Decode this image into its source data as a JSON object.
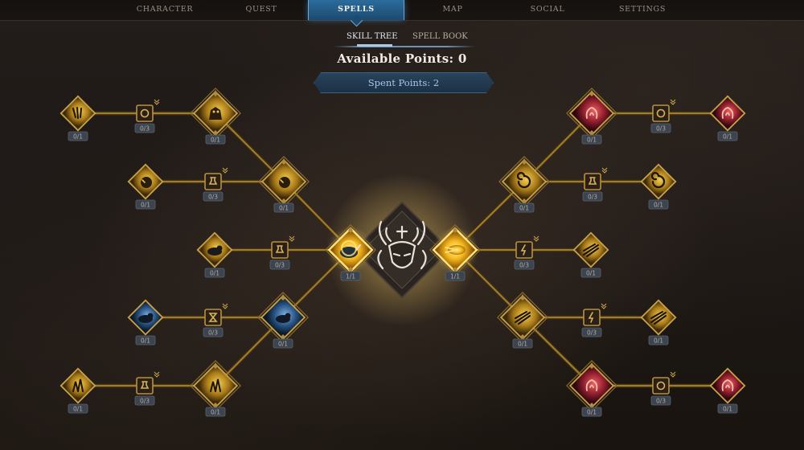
{
  "nav": {
    "tabs": [
      {
        "label": "CHARACTER"
      },
      {
        "label": "QUEST"
      },
      {
        "label": "SPELLS"
      },
      {
        "label": "MAP"
      },
      {
        "label": "SOCIAL"
      },
      {
        "label": "SETTINGS"
      }
    ],
    "active": "SPELLS"
  },
  "subtabs": {
    "skill_tree": "SKILL TREE",
    "spell_book": "SPELL BOOK",
    "active": "SKILL TREE"
  },
  "points": {
    "available": "Available Points: 0",
    "spent": "Spent Points: 2"
  },
  "colors": {
    "accent_blue": "#2b6c9c",
    "gold": "#b9913f",
    "gold_line": "#a07d2e",
    "left_icon": "#c8a033",
    "right_icon": "#c0304a",
    "center_glow": "#f7c52a"
  },
  "center": {
    "name": "class-emblem-icon"
  },
  "nodes": [
    {
      "id": "L1a",
      "icon": "bear-claw-icon",
      "value": "0/1",
      "style": "diamond",
      "tone": "gold"
    },
    {
      "id": "L1b",
      "icon": "ring-icon",
      "value": "0/3",
      "style": "square",
      "tone": "gold",
      "upgrade": true
    },
    {
      "id": "L1c",
      "icon": "earth-golem-icon",
      "value": "0/1",
      "style": "ornate",
      "tone": "gold"
    },
    {
      "id": "L2a",
      "icon": "boulder-icon",
      "value": "0/1",
      "style": "diamond",
      "tone": "gold"
    },
    {
      "id": "L2b",
      "icon": "potion-icon",
      "value": "0/3",
      "style": "square",
      "tone": "gold",
      "upgrade": true
    },
    {
      "id": "L2c",
      "icon": "meteor-icon",
      "value": "0/1",
      "style": "ornate",
      "tone": "gold"
    },
    {
      "id": "L3a",
      "icon": "boar-icon",
      "value": "0/1",
      "style": "diamond",
      "tone": "gold"
    },
    {
      "id": "L3b",
      "icon": "potion-icon",
      "value": "0/3",
      "style": "square",
      "tone": "gold",
      "upgrade": true
    },
    {
      "id": "L3c",
      "icon": "rhino-charge-icon",
      "value": "1/1",
      "style": "ornate",
      "tone": "gold",
      "active": true
    },
    {
      "id": "L4a",
      "icon": "wolf-icon",
      "value": "0/1",
      "style": "diamond",
      "tone": "blue"
    },
    {
      "id": "L4b",
      "icon": "hourglass-icon",
      "value": "0/3",
      "style": "square",
      "tone": "gold",
      "upgrade": true
    },
    {
      "id": "L4c",
      "icon": "beast-icon",
      "value": "0/1",
      "style": "ornate",
      "tone": "blue"
    },
    {
      "id": "L5a",
      "icon": "crystal-icon",
      "value": "0/1",
      "style": "diamond",
      "tone": "gold"
    },
    {
      "id": "L5b",
      "icon": "potion-icon",
      "value": "0/3",
      "style": "square",
      "tone": "gold",
      "upgrade": true
    },
    {
      "id": "L5c",
      "icon": "crystal-cluster-icon",
      "value": "0/1",
      "style": "ornate",
      "tone": "gold"
    },
    {
      "id": "R1a",
      "icon": "red-dragon-icon",
      "value": "0/1",
      "style": "ornate",
      "tone": "red"
    },
    {
      "id": "R1b",
      "icon": "ring-icon",
      "value": "0/3",
      "style": "square",
      "tone": "gold",
      "upgrade": true
    },
    {
      "id": "R1c",
      "icon": "red-rune-icon",
      "value": "0/1",
      "style": "diamond",
      "tone": "red"
    },
    {
      "id": "R2a",
      "icon": "fire-vortex-icon",
      "value": "0/1",
      "style": "ornate",
      "tone": "gold"
    },
    {
      "id": "R2b",
      "icon": "potion-icon",
      "value": "0/3",
      "style": "square",
      "tone": "gold",
      "upgrade": true
    },
    {
      "id": "R2c",
      "icon": "swirl-icon",
      "value": "0/1",
      "style": "diamond",
      "tone": "gold"
    },
    {
      "id": "R3a",
      "icon": "fireball-icon",
      "value": "1/1",
      "style": "ornate",
      "tone": "gold",
      "active": true
    },
    {
      "id": "R3b",
      "icon": "lightning-icon",
      "value": "0/3",
      "style": "square",
      "tone": "gold",
      "upgrade": true
    },
    {
      "id": "R3c",
      "icon": "comet-icon",
      "value": "0/1",
      "style": "diamond",
      "tone": "gold"
    },
    {
      "id": "R4a",
      "icon": "flame-wave-icon",
      "value": "0/1",
      "style": "ornate",
      "tone": "gold"
    },
    {
      "id": "R4b",
      "icon": "lightning-icon",
      "value": "0/3",
      "style": "square",
      "tone": "gold",
      "upgrade": true
    },
    {
      "id": "R4c",
      "icon": "fire-wall-icon",
      "value": "0/1",
      "style": "diamond",
      "tone": "gold"
    },
    {
      "id": "R5a",
      "icon": "demon-fire-icon",
      "value": "0/1",
      "style": "ornate",
      "tone": "red"
    },
    {
      "id": "R5b",
      "icon": "ring-icon",
      "value": "0/3",
      "style": "square",
      "tone": "gold",
      "upgrade": true
    },
    {
      "id": "R5c",
      "icon": "red-flame-icon",
      "value": "0/1",
      "style": "diamond",
      "tone": "red"
    }
  ]
}
